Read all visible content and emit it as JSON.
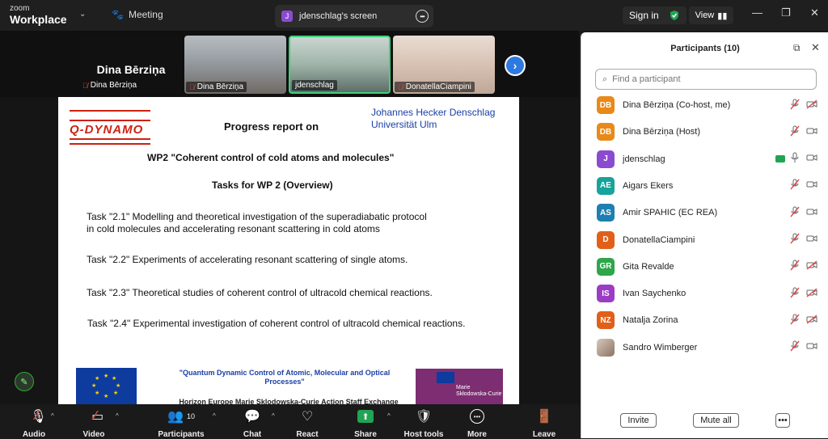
{
  "topbar": {
    "brand_small": "zoom",
    "brand_big": "Workplace",
    "meeting_label": "Meeting",
    "screen_tab_avatar": "J",
    "screen_tab_label": "jdenschlag's screen",
    "signin_label": "Sign in",
    "view_label": "View"
  },
  "strip": {
    "host_name_big": "Dina Bērziņa",
    "host_label": "Dina Bērziņa",
    "tiles": [
      {
        "label": "Dina Bērziņa",
        "muted": true
      },
      {
        "label": "jdenschlag",
        "muted": false
      },
      {
        "label": "DonatellaCiampini",
        "muted": true
      }
    ]
  },
  "slide": {
    "logo_text": "Q-DYNAMO",
    "title": "Progress report on",
    "author_line1": "Johannes Hecker Denschlag",
    "author_line2": "Universität Ulm",
    "wp2": "WP2 \"Coherent control of cold atoms and molecules\"",
    "tasks_heading": "Tasks for WP 2 (Overview)",
    "task1_line1": "Task \"2.1\" Modelling and theoretical investigation of the superadiabatic protocol",
    "task1_line2": "in cold molecules and accelerating resonant scattering in cold atoms",
    "task2": "Task \"2.2\" Experiments of accelerating resonant scattering of single atoms.",
    "task3": "Task \"2.3\" Theoretical studies of coherent control of ultracold chemical reactions.",
    "task4": "Task \"2.4\" Experimental investigation of coherent control of ultracold chemical reactions.",
    "footer_quote": "\"Quantum Dynamic Control of Atomic, Molecular and Optical Processes\"",
    "footer_horizon": "Horizon Europe Marie Sklodowska-Curie Action Staff Exchange",
    "msca_line1": "Marie",
    "msca_line2": "Skłodowska-Curie"
  },
  "toolbar": {
    "audio": "Audio",
    "video": "Video",
    "participants": "Participants",
    "participants_count": "10",
    "chat": "Chat",
    "react": "React",
    "share": "Share",
    "host_tools": "Host tools",
    "more": "More",
    "leave": "Leave"
  },
  "panel": {
    "title": "Participants (10)",
    "search_placeholder": "Find a participant",
    "invite": "Invite",
    "mute_all": "Mute all",
    "participants": [
      {
        "initials": "DB",
        "name": "Dina Bērziņa (Co-host, me)",
        "color": "#e8891a",
        "mic": "off",
        "cam": "off"
      },
      {
        "initials": "DB",
        "name": "Dina Bērziņa (Host)",
        "color": "#e8891a",
        "mic": "off",
        "cam": "on"
      },
      {
        "initials": "J",
        "name": "jdenschlag",
        "color": "#8a4bd1",
        "mic": "on",
        "cam": "on",
        "sharing": true
      },
      {
        "initials": "AE",
        "name": "Aigars Ekers",
        "color": "#16a39b",
        "mic": "off",
        "cam": "on"
      },
      {
        "initials": "AS",
        "name": "Amir SPAHIC (EC REA)",
        "color": "#1e7fb0",
        "mic": "off",
        "cam": "on"
      },
      {
        "initials": "D",
        "name": "DonatellaCiampini",
        "color": "#e0601a",
        "mic": "off",
        "cam": "on"
      },
      {
        "initials": "GR",
        "name": "Gita Revalde",
        "color": "#2fa64a",
        "mic": "off",
        "cam": "off"
      },
      {
        "initials": "IS",
        "name": "Ivan Saychenko",
        "color": "#9b3dc4",
        "mic": "off",
        "cam": "off"
      },
      {
        "initials": "NZ",
        "name": "Natalja Zorina",
        "color": "#e0601a",
        "mic": "off",
        "cam": "off"
      },
      {
        "initials": "",
        "name": "Sandro Wimberger",
        "color": "#7a6a60",
        "mic": "off",
        "cam": "on"
      }
    ]
  }
}
